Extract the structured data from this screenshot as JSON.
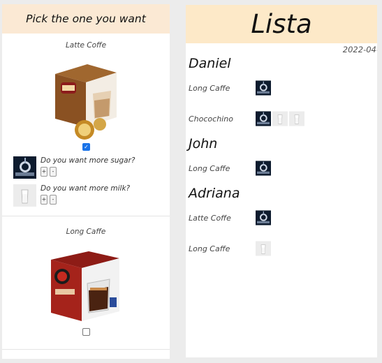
{
  "left": {
    "header": "Pick the one you want",
    "products": [
      {
        "title": "Latte Coffe",
        "checked": true,
        "options": [
          {
            "question": "Do you want more sugar?",
            "plus": "+",
            "minus": "-"
          },
          {
            "question": "Do you want more milk?",
            "plus": "+",
            "minus": "-"
          }
        ]
      },
      {
        "title": "Long Caffe",
        "checked": false
      }
    ]
  },
  "right": {
    "title": "Lista",
    "date": "2022-04-",
    "people": [
      {
        "name": "Daniel",
        "orders": [
          {
            "drink": "Long Caffe",
            "thumbs": [
              "sugar-thumb"
            ]
          },
          {
            "drink": "Chocochino",
            "thumbs": [
              "sugar-thumb",
              "milk-thumb",
              "milk-thumb"
            ]
          }
        ]
      },
      {
        "name": "John",
        "orders": [
          {
            "drink": "Long Caffe",
            "thumbs": [
              "sugar-thumb"
            ]
          }
        ]
      },
      {
        "name": "Adriana",
        "orders": [
          {
            "drink": "Latte Coffe",
            "thumbs": [
              "sugar-thumb"
            ]
          },
          {
            "drink": "Long Caffe",
            "thumbs": [
              "milk-thumb"
            ]
          }
        ]
      }
    ]
  },
  "colors": {
    "left_header_bg": "#fbe9d4",
    "right_header_bg": "#fde9c8",
    "checkbox_accent": "#1a73e8"
  }
}
